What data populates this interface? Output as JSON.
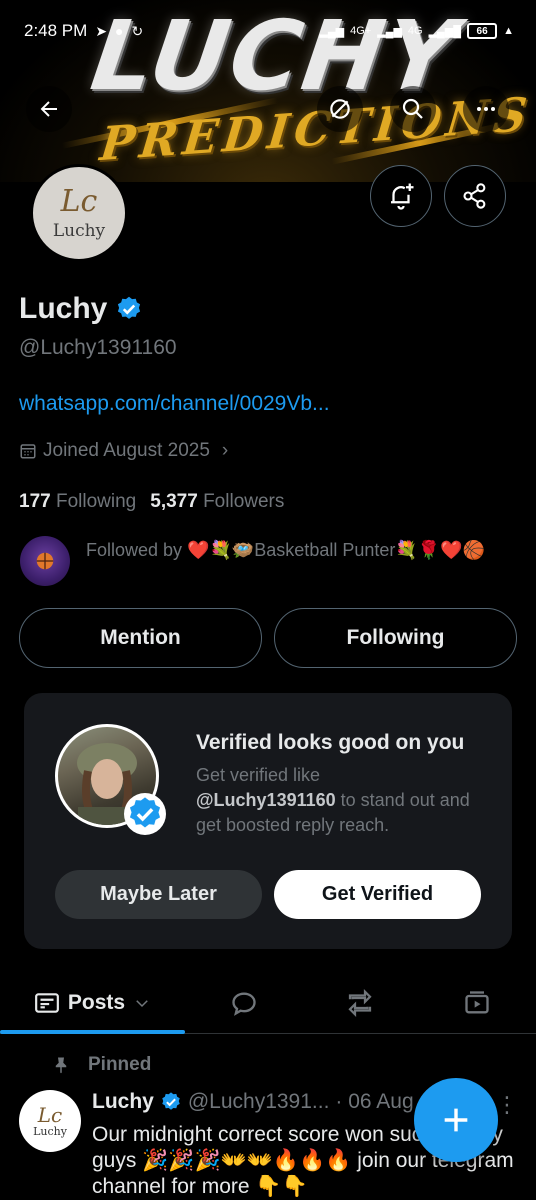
{
  "status_bar": {
    "time": "2:48 PM",
    "network_1": "4G+",
    "network_2": "4G",
    "battery": "66"
  },
  "banner": {
    "title": "LUCHY",
    "subtitle": "PREDICTIONS"
  },
  "header": {
    "back_icon": "arrow-left-icon",
    "grok_icon": "grok-icon",
    "search_icon": "search-icon",
    "more_icon": "more-icon"
  },
  "profile": {
    "avatar_monogram": "Lc",
    "avatar_label": "Luchy",
    "name": "Luchy",
    "handle": "@Luchy1391160",
    "link": "whatsapp.com/channel/0029Vb...",
    "joined": "Joined August 2025",
    "following_count": "177",
    "following_label": "Following",
    "followers_count": "5,377",
    "followers_label": "Followers",
    "followed_by": "Followed by ❤️💐🪺Basketball Punter💐🌹❤️🏀"
  },
  "actions": {
    "mention": "Mention",
    "following": "Following"
  },
  "verified_card": {
    "title": "Verified looks good on you",
    "desc_prefix": "Get verified like",
    "desc_handle": "@Luchy1391160",
    "desc_suffix": "to stand out and get boosted reply reach.",
    "maybe_later": "Maybe Later",
    "get_verified": "Get Verified"
  },
  "tabs": {
    "posts": "Posts"
  },
  "post": {
    "pinned_label": "Pinned",
    "name": "Luchy",
    "handle": "@Luchy1391...",
    "date": "· 06 Aug",
    "avatar_monogram": "Lc",
    "avatar_label": "Luchy",
    "text": "Our midnight correct score won successfully guys 🎉🎉🎉👐👐🔥🔥🔥 join our telegram channel for more 👇👇"
  },
  "colors": {
    "accent": "#1d9bf0",
    "background": "#000000",
    "card": "#16181c",
    "muted": "#71767b"
  }
}
